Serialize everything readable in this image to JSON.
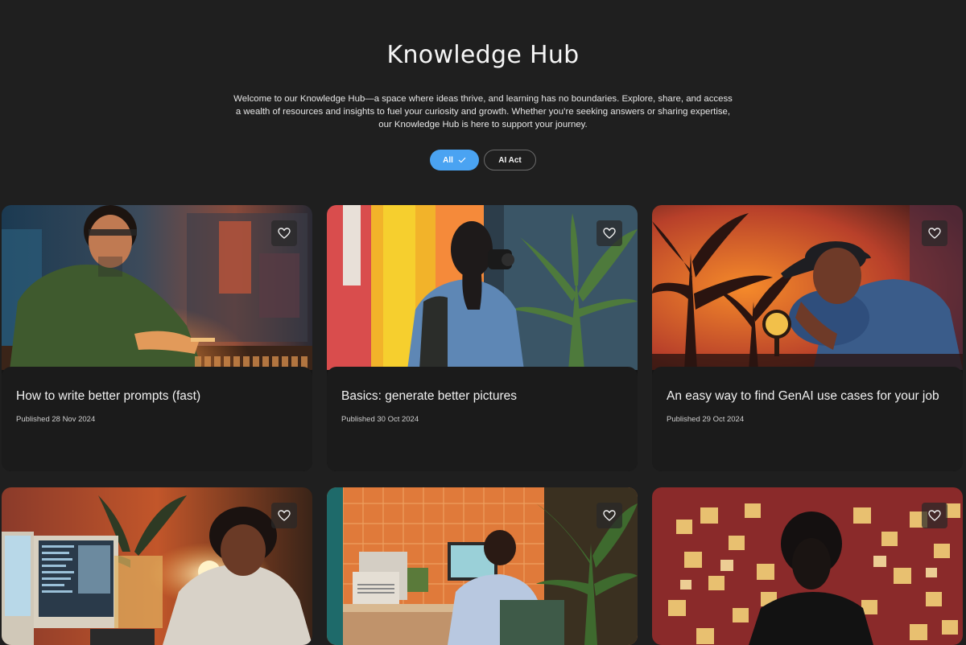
{
  "hero": {
    "title": "Knowledge Hub",
    "description": "Welcome to our Knowledge Hub—a space where ideas thrive, and learning has no boundaries. Explore, share, and access a wealth of resources and insights to fuel your curiosity and growth. Whether you’re seeking answers or sharing expertise, our Knowledge Hub is here to support your journey."
  },
  "filters": [
    {
      "label": "All",
      "active": true
    },
    {
      "label": "AI Act",
      "active": false
    }
  ],
  "colors": {
    "accent": "#4aa3f2",
    "background": "#1f1f1f",
    "card": "#1b1b1b"
  },
  "cards": [
    {
      "title": "How to write better prompts (fast)",
      "date": "Published 28 Nov 2024",
      "icon": "heart-icon"
    },
    {
      "title": "Basics: generate better pictures",
      "date": "Published 30 Oct 2024",
      "icon": "heart-icon"
    },
    {
      "title": "An easy way to find GenAI use cases for your job",
      "date": "Published 29 Oct 2024",
      "icon": "heart-icon"
    },
    {
      "icon": "heart-icon"
    },
    {
      "icon": "heart-icon"
    },
    {
      "icon": "heart-icon"
    }
  ]
}
